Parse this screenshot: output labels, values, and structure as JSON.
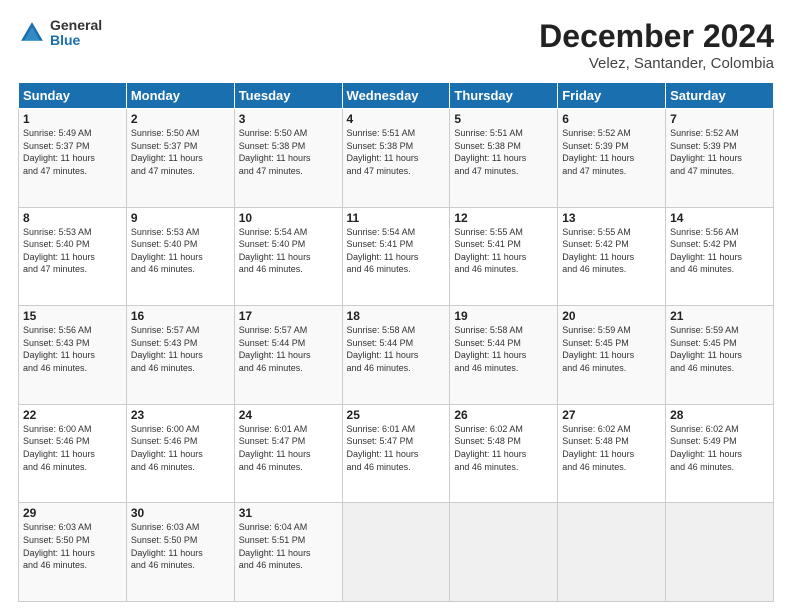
{
  "logo": {
    "general": "General",
    "blue": "Blue"
  },
  "title": "December 2024",
  "location": "Velez, Santander, Colombia",
  "days_of_week": [
    "Sunday",
    "Monday",
    "Tuesday",
    "Wednesday",
    "Thursday",
    "Friday",
    "Saturday"
  ],
  "weeks": [
    [
      {
        "day": "1",
        "info": "Sunrise: 5:49 AM\nSunset: 5:37 PM\nDaylight: 11 hours\nand 47 minutes."
      },
      {
        "day": "2",
        "info": "Sunrise: 5:50 AM\nSunset: 5:37 PM\nDaylight: 11 hours\nand 47 minutes."
      },
      {
        "day": "3",
        "info": "Sunrise: 5:50 AM\nSunset: 5:38 PM\nDaylight: 11 hours\nand 47 minutes."
      },
      {
        "day": "4",
        "info": "Sunrise: 5:51 AM\nSunset: 5:38 PM\nDaylight: 11 hours\nand 47 minutes."
      },
      {
        "day": "5",
        "info": "Sunrise: 5:51 AM\nSunset: 5:38 PM\nDaylight: 11 hours\nand 47 minutes."
      },
      {
        "day": "6",
        "info": "Sunrise: 5:52 AM\nSunset: 5:39 PM\nDaylight: 11 hours\nand 47 minutes."
      },
      {
        "day": "7",
        "info": "Sunrise: 5:52 AM\nSunset: 5:39 PM\nDaylight: 11 hours\nand 47 minutes."
      }
    ],
    [
      {
        "day": "8",
        "info": "Sunrise: 5:53 AM\nSunset: 5:40 PM\nDaylight: 11 hours\nand 47 minutes."
      },
      {
        "day": "9",
        "info": "Sunrise: 5:53 AM\nSunset: 5:40 PM\nDaylight: 11 hours\nand 46 minutes."
      },
      {
        "day": "10",
        "info": "Sunrise: 5:54 AM\nSunset: 5:40 PM\nDaylight: 11 hours\nand 46 minutes."
      },
      {
        "day": "11",
        "info": "Sunrise: 5:54 AM\nSunset: 5:41 PM\nDaylight: 11 hours\nand 46 minutes."
      },
      {
        "day": "12",
        "info": "Sunrise: 5:55 AM\nSunset: 5:41 PM\nDaylight: 11 hours\nand 46 minutes."
      },
      {
        "day": "13",
        "info": "Sunrise: 5:55 AM\nSunset: 5:42 PM\nDaylight: 11 hours\nand 46 minutes."
      },
      {
        "day": "14",
        "info": "Sunrise: 5:56 AM\nSunset: 5:42 PM\nDaylight: 11 hours\nand 46 minutes."
      }
    ],
    [
      {
        "day": "15",
        "info": "Sunrise: 5:56 AM\nSunset: 5:43 PM\nDaylight: 11 hours\nand 46 minutes."
      },
      {
        "day": "16",
        "info": "Sunrise: 5:57 AM\nSunset: 5:43 PM\nDaylight: 11 hours\nand 46 minutes."
      },
      {
        "day": "17",
        "info": "Sunrise: 5:57 AM\nSunset: 5:44 PM\nDaylight: 11 hours\nand 46 minutes."
      },
      {
        "day": "18",
        "info": "Sunrise: 5:58 AM\nSunset: 5:44 PM\nDaylight: 11 hours\nand 46 minutes."
      },
      {
        "day": "19",
        "info": "Sunrise: 5:58 AM\nSunset: 5:44 PM\nDaylight: 11 hours\nand 46 minutes."
      },
      {
        "day": "20",
        "info": "Sunrise: 5:59 AM\nSunset: 5:45 PM\nDaylight: 11 hours\nand 46 minutes."
      },
      {
        "day": "21",
        "info": "Sunrise: 5:59 AM\nSunset: 5:45 PM\nDaylight: 11 hours\nand 46 minutes."
      }
    ],
    [
      {
        "day": "22",
        "info": "Sunrise: 6:00 AM\nSunset: 5:46 PM\nDaylight: 11 hours\nand 46 minutes."
      },
      {
        "day": "23",
        "info": "Sunrise: 6:00 AM\nSunset: 5:46 PM\nDaylight: 11 hours\nand 46 minutes."
      },
      {
        "day": "24",
        "info": "Sunrise: 6:01 AM\nSunset: 5:47 PM\nDaylight: 11 hours\nand 46 minutes."
      },
      {
        "day": "25",
        "info": "Sunrise: 6:01 AM\nSunset: 5:47 PM\nDaylight: 11 hours\nand 46 minutes."
      },
      {
        "day": "26",
        "info": "Sunrise: 6:02 AM\nSunset: 5:48 PM\nDaylight: 11 hours\nand 46 minutes."
      },
      {
        "day": "27",
        "info": "Sunrise: 6:02 AM\nSunset: 5:48 PM\nDaylight: 11 hours\nand 46 minutes."
      },
      {
        "day": "28",
        "info": "Sunrise: 6:02 AM\nSunset: 5:49 PM\nDaylight: 11 hours\nand 46 minutes."
      }
    ],
    [
      {
        "day": "29",
        "info": "Sunrise: 6:03 AM\nSunset: 5:50 PM\nDaylight: 11 hours\nand 46 minutes."
      },
      {
        "day": "30",
        "info": "Sunrise: 6:03 AM\nSunset: 5:50 PM\nDaylight: 11 hours\nand 46 minutes."
      },
      {
        "day": "31",
        "info": "Sunrise: 6:04 AM\nSunset: 5:51 PM\nDaylight: 11 hours\nand 46 minutes."
      },
      {
        "day": "",
        "info": ""
      },
      {
        "day": "",
        "info": ""
      },
      {
        "day": "",
        "info": ""
      },
      {
        "day": "",
        "info": ""
      }
    ]
  ]
}
